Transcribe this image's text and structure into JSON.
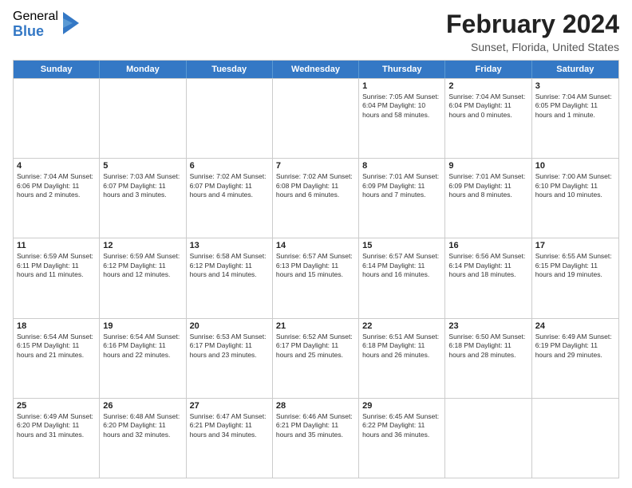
{
  "logo": {
    "general": "General",
    "blue": "Blue"
  },
  "title": {
    "month_year": "February 2024",
    "location": "Sunset, Florida, United States"
  },
  "weekdays": [
    "Sunday",
    "Monday",
    "Tuesday",
    "Wednesday",
    "Thursday",
    "Friday",
    "Saturday"
  ],
  "weeks": [
    [
      {
        "day": "",
        "info": ""
      },
      {
        "day": "",
        "info": ""
      },
      {
        "day": "",
        "info": ""
      },
      {
        "day": "",
        "info": ""
      },
      {
        "day": "1",
        "info": "Sunrise: 7:05 AM\nSunset: 6:04 PM\nDaylight: 10 hours and 58 minutes."
      },
      {
        "day": "2",
        "info": "Sunrise: 7:04 AM\nSunset: 6:04 PM\nDaylight: 11 hours and 0 minutes."
      },
      {
        "day": "3",
        "info": "Sunrise: 7:04 AM\nSunset: 6:05 PM\nDaylight: 11 hours and 1 minute."
      }
    ],
    [
      {
        "day": "4",
        "info": "Sunrise: 7:04 AM\nSunset: 6:06 PM\nDaylight: 11 hours and 2 minutes."
      },
      {
        "day": "5",
        "info": "Sunrise: 7:03 AM\nSunset: 6:07 PM\nDaylight: 11 hours and 3 minutes."
      },
      {
        "day": "6",
        "info": "Sunrise: 7:02 AM\nSunset: 6:07 PM\nDaylight: 11 hours and 4 minutes."
      },
      {
        "day": "7",
        "info": "Sunrise: 7:02 AM\nSunset: 6:08 PM\nDaylight: 11 hours and 6 minutes."
      },
      {
        "day": "8",
        "info": "Sunrise: 7:01 AM\nSunset: 6:09 PM\nDaylight: 11 hours and 7 minutes."
      },
      {
        "day": "9",
        "info": "Sunrise: 7:01 AM\nSunset: 6:09 PM\nDaylight: 11 hours and 8 minutes."
      },
      {
        "day": "10",
        "info": "Sunrise: 7:00 AM\nSunset: 6:10 PM\nDaylight: 11 hours and 10 minutes."
      }
    ],
    [
      {
        "day": "11",
        "info": "Sunrise: 6:59 AM\nSunset: 6:11 PM\nDaylight: 11 hours and 11 minutes."
      },
      {
        "day": "12",
        "info": "Sunrise: 6:59 AM\nSunset: 6:12 PM\nDaylight: 11 hours and 12 minutes."
      },
      {
        "day": "13",
        "info": "Sunrise: 6:58 AM\nSunset: 6:12 PM\nDaylight: 11 hours and 14 minutes."
      },
      {
        "day": "14",
        "info": "Sunrise: 6:57 AM\nSunset: 6:13 PM\nDaylight: 11 hours and 15 minutes."
      },
      {
        "day": "15",
        "info": "Sunrise: 6:57 AM\nSunset: 6:14 PM\nDaylight: 11 hours and 16 minutes."
      },
      {
        "day": "16",
        "info": "Sunrise: 6:56 AM\nSunset: 6:14 PM\nDaylight: 11 hours and 18 minutes."
      },
      {
        "day": "17",
        "info": "Sunrise: 6:55 AM\nSunset: 6:15 PM\nDaylight: 11 hours and 19 minutes."
      }
    ],
    [
      {
        "day": "18",
        "info": "Sunrise: 6:54 AM\nSunset: 6:15 PM\nDaylight: 11 hours and 21 minutes."
      },
      {
        "day": "19",
        "info": "Sunrise: 6:54 AM\nSunset: 6:16 PM\nDaylight: 11 hours and 22 minutes."
      },
      {
        "day": "20",
        "info": "Sunrise: 6:53 AM\nSunset: 6:17 PM\nDaylight: 11 hours and 23 minutes."
      },
      {
        "day": "21",
        "info": "Sunrise: 6:52 AM\nSunset: 6:17 PM\nDaylight: 11 hours and 25 minutes."
      },
      {
        "day": "22",
        "info": "Sunrise: 6:51 AM\nSunset: 6:18 PM\nDaylight: 11 hours and 26 minutes."
      },
      {
        "day": "23",
        "info": "Sunrise: 6:50 AM\nSunset: 6:18 PM\nDaylight: 11 hours and 28 minutes."
      },
      {
        "day": "24",
        "info": "Sunrise: 6:49 AM\nSunset: 6:19 PM\nDaylight: 11 hours and 29 minutes."
      }
    ],
    [
      {
        "day": "25",
        "info": "Sunrise: 6:49 AM\nSunset: 6:20 PM\nDaylight: 11 hours and 31 minutes."
      },
      {
        "day": "26",
        "info": "Sunrise: 6:48 AM\nSunset: 6:20 PM\nDaylight: 11 hours and 32 minutes."
      },
      {
        "day": "27",
        "info": "Sunrise: 6:47 AM\nSunset: 6:21 PM\nDaylight: 11 hours and 34 minutes."
      },
      {
        "day": "28",
        "info": "Sunrise: 6:46 AM\nSunset: 6:21 PM\nDaylight: 11 hours and 35 minutes."
      },
      {
        "day": "29",
        "info": "Sunrise: 6:45 AM\nSunset: 6:22 PM\nDaylight: 11 hours and 36 minutes."
      },
      {
        "day": "",
        "info": ""
      },
      {
        "day": "",
        "info": ""
      }
    ]
  ]
}
